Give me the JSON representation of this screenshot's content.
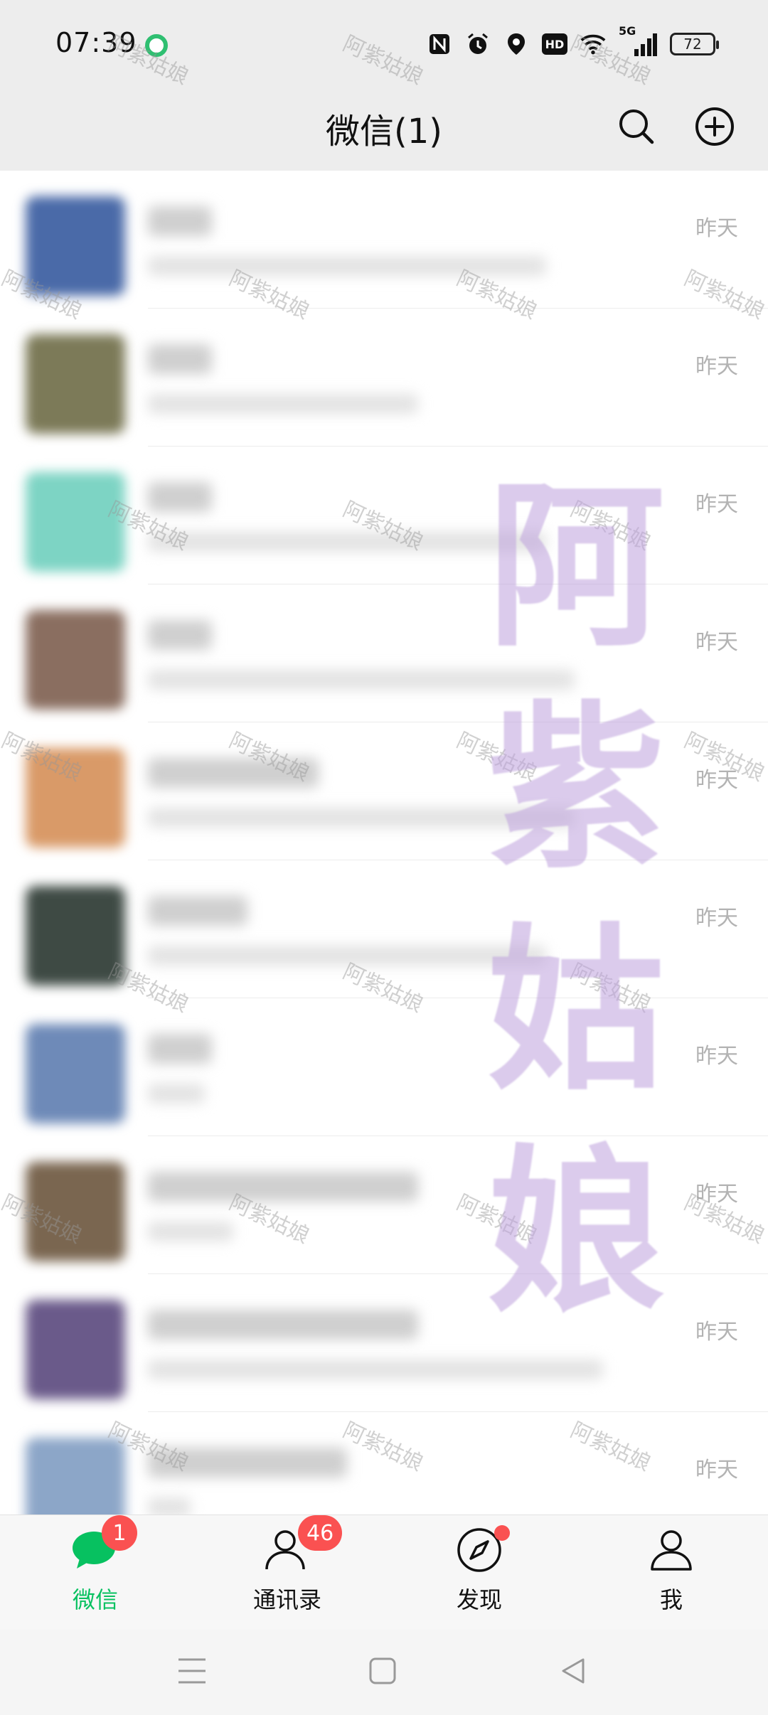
{
  "status_bar": {
    "time": "07:39",
    "battery": "72",
    "signal_label": "5G"
  },
  "header": {
    "title": "微信(1)"
  },
  "chats": [
    {
      "time": "昨天",
      "avatar_color": "#4a6aa8",
      "name_w": 90,
      "preview_w": 560
    },
    {
      "time": "昨天",
      "avatar_color": "#7c7a58",
      "name_w": 90,
      "preview_w": 380
    },
    {
      "time": "昨天",
      "avatar_color": "#7dd4c4",
      "name_w": 90,
      "preview_w": 560
    },
    {
      "time": "昨天",
      "avatar_color": "#8a6e60",
      "name_w": 90,
      "preview_w": 600
    },
    {
      "time": "昨天",
      "avatar_color": "#d99a68",
      "name_w": 240,
      "preview_w": 600
    },
    {
      "time": "昨天",
      "avatar_color": "#3e4a44",
      "name_w": 140,
      "preview_w": 560
    },
    {
      "time": "昨天",
      "avatar_color": "#6e8ab8",
      "name_w": 90,
      "preview_w": 80
    },
    {
      "time": "昨天",
      "avatar_color": "#7a6650",
      "name_w": 380,
      "preview_w": 120
    },
    {
      "time": "昨天",
      "avatar_color": "#6a5a8a",
      "name_w": 380,
      "preview_w": 640
    },
    {
      "time": "昨天",
      "avatar_color": "#8ca6c8",
      "name_w": 280,
      "preview_w": 60
    }
  ],
  "watermark": {
    "text": "阿紫姑娘",
    "big_chars": [
      "阿",
      "紫",
      "姑",
      "娘"
    ]
  },
  "bottom_nav": {
    "items": [
      {
        "label": "微信",
        "icon": "chat-bubble-icon",
        "active": true
      },
      {
        "label": "通讯录",
        "icon": "contacts-icon",
        "active": false
      },
      {
        "label": "发现",
        "icon": "compass-icon",
        "active": false
      },
      {
        "label": "我",
        "icon": "person-icon",
        "active": false
      }
    ],
    "chats_badge": "1",
    "contacts_badge": "46"
  },
  "colors": {
    "accent": "#07c160",
    "badge": "#fa5151",
    "header_bg": "#ededed"
  }
}
